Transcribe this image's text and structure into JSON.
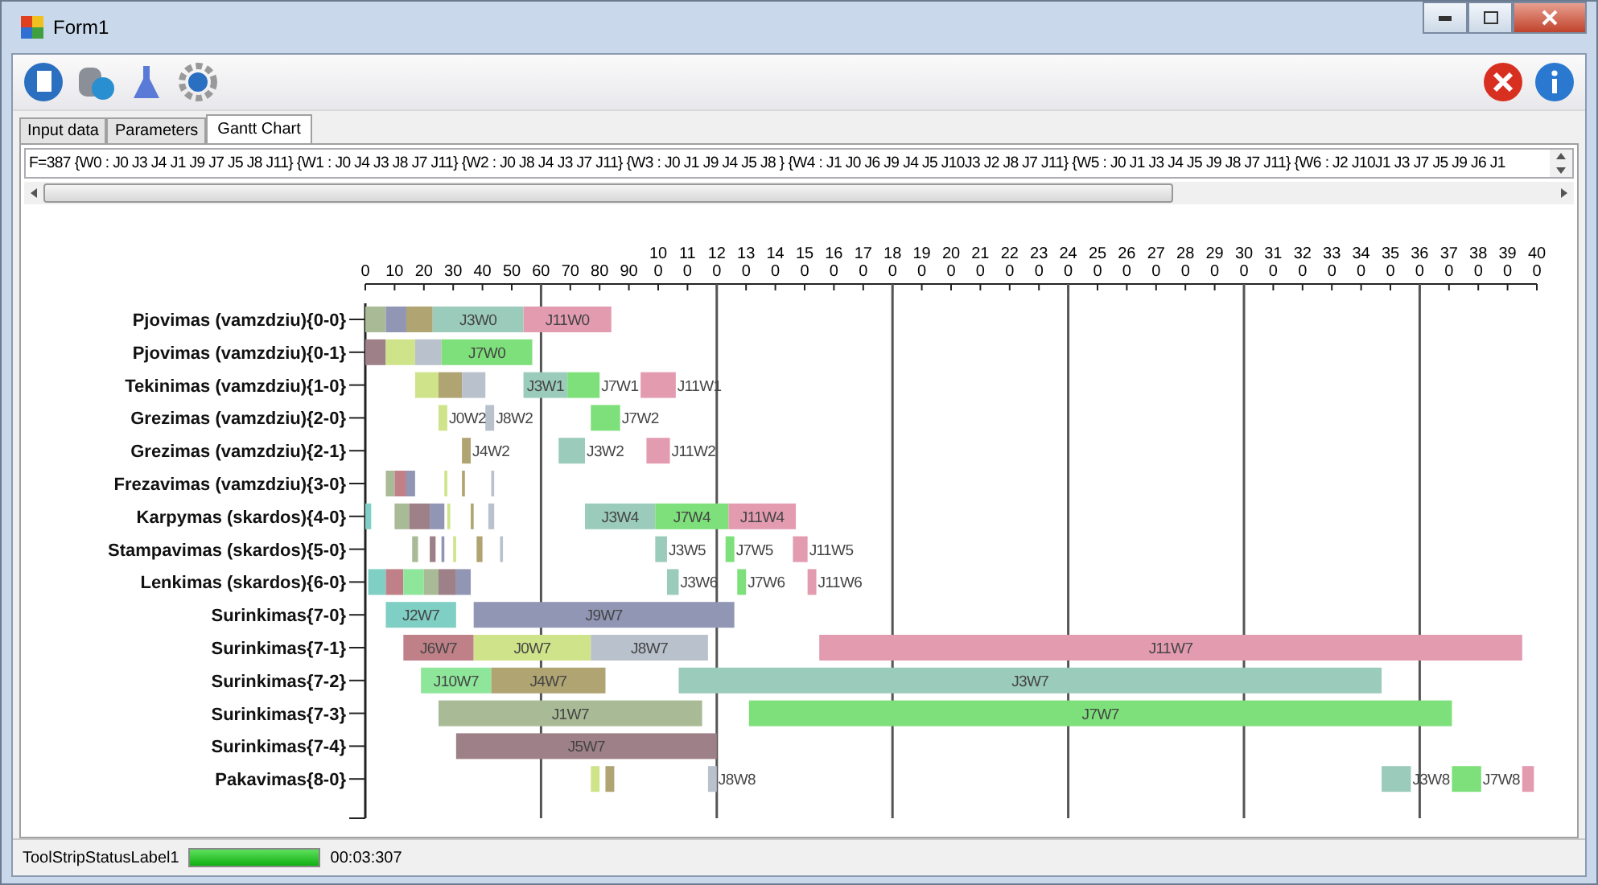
{
  "window": {
    "title": "Form1"
  },
  "tabs": [
    {
      "label": "Input data",
      "selected": false
    },
    {
      "label": "Parameters",
      "selected": false
    },
    {
      "label": "Gantt Chart",
      "selected": true
    }
  ],
  "schedule_text": "F=387 {W0  : J0 J3 J4 J1 J9 J7 J5 J8 J11}  {W1  : J0 J4 J3 J8 J7 J11}  {W2  : J0 J8 J4 J3 J7 J11}  {W3  : J0 J1 J9 J4 J5 J8 }  {W4  : J1 J0 J6 J9 J4 J5 J10J3 J2 J8 J7 J11}  {W5  : J0 J1 J3 J4 J5 J9 J8 J7 J11}  {W6  : J2 J10J1 J3 J7 J5 J9 J6 J1",
  "gantt": {
    "tick_labels": [
      "0",
      "10",
      "20",
      "30",
      "40",
      "50",
      "60",
      "70",
      "80",
      "90",
      "100",
      "110",
      "120",
      "130",
      "140",
      "150",
      "160",
      "170",
      "180",
      "190",
      "200",
      "210",
      "220",
      "230",
      "240",
      "250",
      "260",
      "270",
      "280",
      "290",
      "300",
      "310",
      "320",
      "330",
      "340",
      "350",
      "360",
      "370",
      "380",
      "390",
      "400"
    ],
    "rows": [
      {
        "label": "Pjovimas (vamzdziu){0-0}",
        "bars": [
          {
            "color": "#a9ba96"
          },
          {
            "color": "#9196b4"
          },
          {
            "color": "#b0a472"
          },
          {
            "color": "#9bcbbb",
            "label": "J3W0"
          },
          {
            "color": "#e39bb0",
            "label": "J11W0"
          }
        ]
      },
      {
        "label": "Pjovimas (vamzdziu){0-1}",
        "bars": [
          {
            "color": "#9e8088"
          },
          {
            "color": "#cfe48a"
          },
          {
            "color": "#b9c1cc"
          },
          {
            "color": "#7ee07a",
            "label": "J7W0"
          }
        ]
      },
      {
        "label": "Tekinimas (vamzdziu){1-0}",
        "bars": [
          {
            "color": "#cfe48a"
          },
          {
            "color": "#b0a472"
          },
          {
            "color": "#b9c1cc"
          },
          {
            "color": "#9bcbbb",
            "label": "J3W1"
          },
          {
            "color": "#7ee07a",
            "label": "J7W1"
          },
          {
            "color": "#e39bb0",
            "label": "J11W1"
          }
        ]
      },
      {
        "label": "Grezimas (vamzdziu){2-0}",
        "bars": [
          {
            "color": "#cfe48a",
            "label": "J0W2"
          },
          {
            "color": "#b9c1cc",
            "label": "J8W2"
          },
          {
            "color": "#7ee07a",
            "label": "J7W2"
          }
        ]
      },
      {
        "label": "Grezimas (vamzdziu){2-1}",
        "bars": [
          {
            "color": "#b0a472",
            "label": "J4W2"
          },
          {
            "color": "#9bcbbb",
            "label": "J3W2"
          },
          {
            "color": "#e39bb0",
            "label": "J11W2"
          }
        ]
      },
      {
        "label": "Frezavimas (vamzdziu){3-0}",
        "bars": [
          {
            "color": "#a9ba96"
          },
          {
            "color": "#c08088"
          },
          {
            "color": "#9196b4"
          },
          {
            "color": "#cfe48a"
          },
          {
            "color": "#b0a472"
          },
          {
            "color": "#b9c1cc"
          }
        ]
      },
      {
        "label": "Karpymas (skardos){4-0}",
        "bars": [
          {
            "color": "#7fcfc4"
          },
          {
            "color": "#a9ba96"
          },
          {
            "color": "#9e8088"
          },
          {
            "color": "#9196b4"
          },
          {
            "color": "#cfe48a"
          },
          {
            "color": "#b0a472"
          },
          {
            "color": "#b9c1cc"
          },
          {
            "color": "#9bcbbb",
            "label": "J3W4"
          },
          {
            "color": "#7ee07a",
            "label": "J7W4"
          },
          {
            "color": "#e39bb0",
            "label": "J11W4"
          }
        ]
      },
      {
        "label": "Stampavimas (skardos){5-0}",
        "bars": [
          {
            "color": "#a9ba96"
          },
          {
            "color": "#9e8088"
          },
          {
            "color": "#9196b4"
          },
          {
            "color": "#cfe48a"
          },
          {
            "color": "#b0a472"
          },
          {
            "color": "#b9c1cc"
          },
          {
            "color": "#9bcbbb",
            "label": "J3W5"
          },
          {
            "color": "#7ee07a",
            "label": "J7W5"
          },
          {
            "color": "#e39bb0",
            "label": "J11W5"
          }
        ]
      },
      {
        "label": "Lenkimas (skardos){6-0}",
        "bars": [
          {
            "color": "#7fcfc4"
          },
          {
            "color": "#c08088"
          },
          {
            "color": "#8ee69a"
          },
          {
            "color": "#a9ba96"
          },
          {
            "color": "#9e8088"
          },
          {
            "color": "#9196b4"
          },
          {
            "color": "#9bcbbb",
            "label": "J3W6"
          },
          {
            "color": "#7ee07a",
            "label": "J7W6"
          },
          {
            "color": "#e39bb0",
            "label": "J11W6"
          }
        ]
      },
      {
        "label": "Surinkimas{7-0}",
        "bars": [
          {
            "color": "#7fcfc4",
            "label": "J2W7"
          },
          {
            "color": "#9196b4",
            "label": "J9W7"
          }
        ]
      },
      {
        "label": "Surinkimas{7-1}",
        "bars": [
          {
            "color": "#c08088",
            "label": "J6W7"
          },
          {
            "color": "#cfe48a",
            "label": "J0W7"
          },
          {
            "color": "#b9c1cc",
            "label": "J8W7"
          },
          {
            "color": "#e39bb0",
            "label": "J11W7"
          }
        ]
      },
      {
        "label": "Surinkimas{7-2}",
        "bars": [
          {
            "color": "#8ee69a",
            "label": "J10W7"
          },
          {
            "color": "#b0a472",
            "label": "J4W7"
          },
          {
            "color": "#9bcbbb",
            "label": "J3W7"
          }
        ]
      },
      {
        "label": "Surinkimas{7-3}",
        "bars": [
          {
            "color": "#a9ba96",
            "label": "J1W7"
          },
          {
            "color": "#7ee07a",
            "label": "J7W7"
          }
        ]
      },
      {
        "label": "Surinkimas{7-4}",
        "bars": [
          {
            "color": "#9e8088",
            "label": "J5W7"
          }
        ]
      },
      {
        "label": "Pakavimas{8-0}",
        "bars": [
          {
            "color": "#cfe48a"
          },
          {
            "color": "#b0a472"
          },
          {
            "color": "#b9c1cc",
            "label": "J8W8"
          },
          {
            "color": "#9bcbbb",
            "label": "J3W8"
          },
          {
            "color": "#7ee07a",
            "label": "J7W8"
          },
          {
            "color": "#e39bb0"
          }
        ]
      }
    ]
  },
  "status_bar": {
    "label": "ToolStripStatusLabel1",
    "progress": {
      "level": 1
    },
    "time": "00:03:307"
  }
}
